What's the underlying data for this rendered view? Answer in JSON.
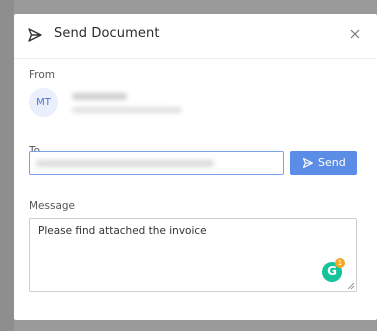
{
  "dialog": {
    "title": "Send Document",
    "title_icon": "paper-plane-icon",
    "close_icon": "close-icon"
  },
  "from": {
    "label": "From",
    "avatar_initials": "MT"
  },
  "to": {
    "label": "To",
    "send_label": "Send",
    "send_icon": "paper-plane-icon"
  },
  "message": {
    "label": "Message",
    "value": "Please find attached the invoice",
    "grammarly_letter": "G",
    "grammarly_count": "1"
  },
  "colors": {
    "accent": "#5b8ce6",
    "input_focus_border": "#7aa2e8",
    "grammarly": "#15c39a"
  }
}
